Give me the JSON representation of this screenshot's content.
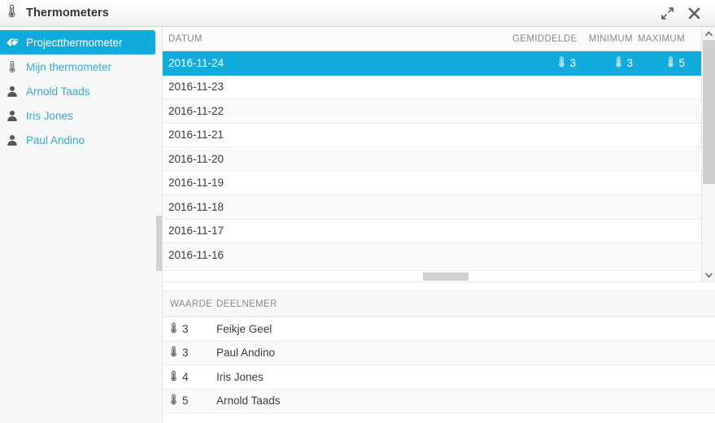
{
  "window": {
    "title": "Thermometers",
    "title_icon": "thermometer-icon",
    "expand_label": "⤡",
    "close_label": "✖",
    "accent_color": "#12abdb",
    "link_color": "#3ca8cf"
  },
  "sidebar": {
    "items": [
      {
        "label": "Projectthermometer",
        "icon": "tags-icon",
        "selected": true
      },
      {
        "label": "Mijn thermometer",
        "icon": "thermometer-icon",
        "selected": false
      },
      {
        "label": "Arnold Taads",
        "icon": "person-icon",
        "selected": false
      },
      {
        "label": "Iris Jones",
        "icon": "person-icon",
        "selected": false
      },
      {
        "label": "Paul Andino",
        "icon": "person-icon",
        "selected": false
      }
    ]
  },
  "top_grid": {
    "columns": {
      "date": "DATUM",
      "average": "GEMIDDELDE",
      "minimum": "MINIMUM",
      "maximum": "MAXIMUM"
    },
    "rows": [
      {
        "date": "2016-11-24",
        "average": "3",
        "minimum": "3",
        "maximum": "5",
        "selected": true
      },
      {
        "date": "2016-11-23",
        "average": "",
        "minimum": "",
        "maximum": "",
        "selected": false
      },
      {
        "date": "2016-11-22",
        "average": "",
        "minimum": "",
        "maximum": "",
        "selected": false
      },
      {
        "date": "2016-11-21",
        "average": "",
        "minimum": "",
        "maximum": "",
        "selected": false
      },
      {
        "date": "2016-11-20",
        "average": "",
        "minimum": "",
        "maximum": "",
        "selected": false
      },
      {
        "date": "2016-11-19",
        "average": "",
        "minimum": "",
        "maximum": "",
        "selected": false
      },
      {
        "date": "2016-11-18",
        "average": "",
        "minimum": "",
        "maximum": "",
        "selected": false
      },
      {
        "date": "2016-11-17",
        "average": "",
        "minimum": "",
        "maximum": "",
        "selected": false
      },
      {
        "date": "2016-11-16",
        "average": "",
        "minimum": "",
        "maximum": "",
        "selected": false
      }
    ]
  },
  "bottom_grid": {
    "columns": {
      "value": "WAARDE",
      "participant": "DEELNEMER"
    },
    "rows": [
      {
        "value": "3",
        "participant": "Feikje Geel"
      },
      {
        "value": "3",
        "participant": "Paul Andino"
      },
      {
        "value": "4",
        "participant": "Iris Jones"
      },
      {
        "value": "5",
        "participant": "Arnold Taads"
      }
    ]
  }
}
